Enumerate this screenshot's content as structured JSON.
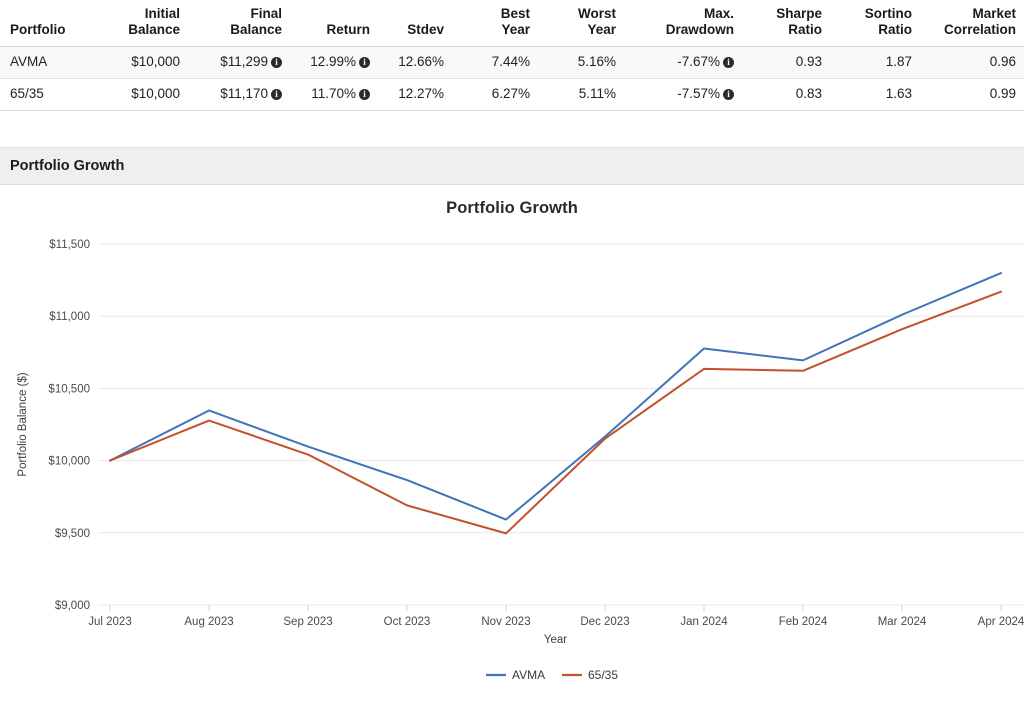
{
  "metrics_table": {
    "name": "portfolio-metrics-table",
    "columns": [
      "Portfolio",
      "Initial Balance",
      "Final Balance",
      "Return",
      "Stdev",
      "Best Year",
      "Worst Year",
      "Max. Drawdown",
      "Sharpe Ratio",
      "Sortino Ratio",
      "Market Correlation"
    ],
    "columns_lines": [
      [
        "Portfolio"
      ],
      [
        "Initial",
        "Balance"
      ],
      [
        "Final",
        "Balance"
      ],
      [
        "Return"
      ],
      [
        "Stdev"
      ],
      [
        "Best",
        "Year"
      ],
      [
        "Worst",
        "Year"
      ],
      [
        "Max.",
        "Drawdown"
      ],
      [
        "Sharpe",
        "Ratio"
      ],
      [
        "Sortino",
        "Ratio"
      ],
      [
        "Market",
        "Correlation"
      ]
    ],
    "rows": [
      {
        "portfolio": "AVMA",
        "initial_balance": "$10,000",
        "final_balance": "$11,299",
        "final_balance_info": true,
        "return": "12.99%",
        "return_info": true,
        "stdev": "12.66%",
        "best_year": "7.44%",
        "worst_year": "5.16%",
        "max_drawdown": "-7.67%",
        "max_drawdown_info": true,
        "sharpe_ratio": "0.93",
        "sortino_ratio": "1.87",
        "market_correlation": "0.96"
      },
      {
        "portfolio": "65/35",
        "initial_balance": "$10,000",
        "final_balance": "$11,170",
        "final_balance_info": true,
        "return": "11.70%",
        "return_info": true,
        "stdev": "12.27%",
        "best_year": "6.27%",
        "worst_year": "5.11%",
        "max_drawdown": "-7.57%",
        "max_drawdown_info": true,
        "sharpe_ratio": "0.83",
        "sortino_ratio": "1.63",
        "market_correlation": "0.99"
      }
    ],
    "info_icon_glyph": "i",
    "info_icon_name": "info-icon"
  },
  "section": {
    "title": "Portfolio Growth"
  },
  "chart_data": {
    "type": "line",
    "title": "Portfolio Growth",
    "xlabel": "Year",
    "ylabel": "Portfolio Balance ($)",
    "categories": [
      "Jul 2023",
      "Aug 2023",
      "Sep 2023",
      "Oct 2023",
      "Nov 2023",
      "Dec 2023",
      "Jan 2024",
      "Feb 2024",
      "Mar 2024",
      "Apr 2024"
    ],
    "ylim": [
      9000,
      11500
    ],
    "yticks": [
      9000,
      9500,
      10000,
      10500,
      11000,
      11500
    ],
    "ytick_labels": [
      "$9,000",
      "$9,500",
      "$10,000",
      "$10,500",
      "$11,000",
      "$11,500"
    ],
    "grid": true,
    "legend_position": "bottom-center",
    "series": [
      {
        "name": "AVMA",
        "color": "#4272b8",
        "values": [
          10000,
          10347,
          10097,
          9865,
          9592,
          10166,
          10776,
          10694,
          11010,
          11299
        ]
      },
      {
        "name": "65/35",
        "color": "#c2512c",
        "values": [
          10000,
          10277,
          10042,
          9690,
          9496,
          10152,
          10635,
          10622,
          10910,
          11170
        ]
      }
    ]
  }
}
